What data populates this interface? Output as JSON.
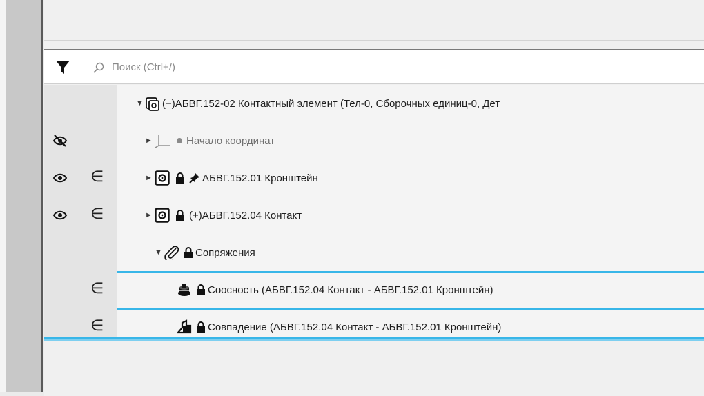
{
  "search": {
    "placeholder": "Поиск (Ctrl+/)"
  },
  "icons": {
    "filter": "filter-funnel-icon",
    "search": "magnifier-icon",
    "visibility_on": "eye-icon",
    "visibility_off": "eye-crossed-icon",
    "belongs": "element-of-icon",
    "assembly": "assembly-icon",
    "part": "part-icon",
    "lock": "lock-icon",
    "pin": "pin-icon",
    "mates": "paperclip-icon",
    "concentric": "concentric-mate-icon",
    "coincident": "coincident-mate-icon",
    "origin": "origin-axes-icon"
  },
  "colors": {
    "selection": "#38b6e8",
    "text": "#1e1e1e",
    "muted_text": "#707070"
  },
  "tree": {
    "root": {
      "expander": "▼",
      "prefix": "(−)",
      "label": "АБВГ.152-02 Контактный элемент (Тел-0, Сборочных единиц-0, Дет"
    },
    "items": [
      {
        "expander": "►",
        "label": "Начало координат"
      },
      {
        "expander": "►",
        "label": "АБВГ.152.01 Кронштейн"
      },
      {
        "expander": "►",
        "prefix": "(+)",
        "label": "АБВГ.152.04 Контакт"
      },
      {
        "expander": "▼",
        "label": "Сопряжения"
      },
      {
        "label": "Соосность (АБВГ.152.04 Контакт  -  АБВГ.152.01 Кронштейн)"
      },
      {
        "label": "Совпадение (АБВГ.152.04 Контакт  -  АБВГ.152.01 Кронштейн)"
      }
    ]
  },
  "column_symbols": {
    "belongs": "∈"
  }
}
